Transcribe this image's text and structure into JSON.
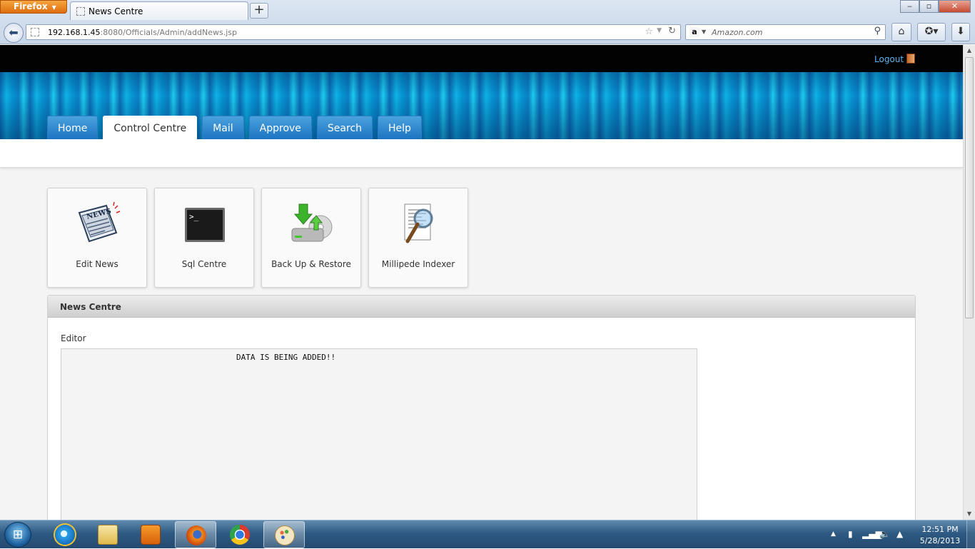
{
  "browser": {
    "menu_button": "Firefox",
    "tab_title": "News Centre",
    "new_tab": "+",
    "url_host": "192.168.1.45",
    "url_path": ":8080/Officials/Admin/addNews.jsp",
    "search_placeholder": "Amazon.com",
    "search_engine": "a",
    "window_buttons": {
      "minimize": "‒",
      "maximize": "▫",
      "close": "✕"
    }
  },
  "site": {
    "logout": "Logout",
    "nav_tabs": [
      {
        "label": "Home",
        "active": false
      },
      {
        "label": "Control Centre",
        "active": true
      },
      {
        "label": "Mail",
        "active": false
      },
      {
        "label": "Approve",
        "active": false
      },
      {
        "label": "Search",
        "active": false
      },
      {
        "label": "Help",
        "active": false
      }
    ],
    "tiles": [
      {
        "label": "Edit News",
        "icon": "newspaper-icon"
      },
      {
        "label": "Sql Centre",
        "icon": "terminal-icon"
      },
      {
        "label": "Back Up & Restore",
        "icon": "backup-restore-icon"
      },
      {
        "label": "Millipede Indexer",
        "icon": "magnifier-document-icon"
      }
    ],
    "panel": {
      "title": "News Centre",
      "editor_label": "Editor",
      "editor_text": "DATA IS BEING ADDED!!"
    }
  },
  "taskbar": {
    "apps": [
      {
        "name": "internet-explorer-icon",
        "active": false
      },
      {
        "name": "file-explorer-icon",
        "active": false
      },
      {
        "name": "media-player-icon",
        "active": false
      },
      {
        "name": "firefox-icon",
        "active": true
      },
      {
        "name": "chrome-icon",
        "active": false
      },
      {
        "name": "paint-icon",
        "active": true
      }
    ],
    "time": "12:51 PM",
    "date": "5/28/2013"
  },
  "colors": {
    "nav_tab": "#1c74c2",
    "banner": "#0fb4e6",
    "logout": "#5bb4ef",
    "topbar": "#020202"
  }
}
